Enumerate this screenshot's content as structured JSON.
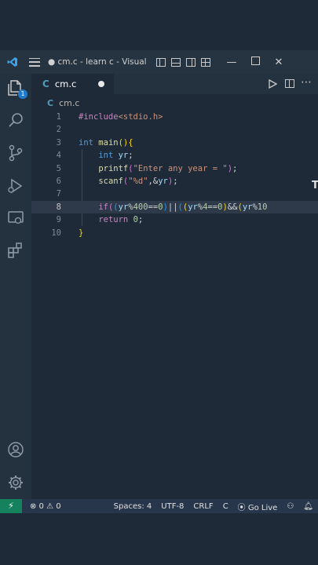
{
  "titlebar": {
    "title": "● cm.c - learn c - Visual ...",
    "minimize": "—",
    "close": "✕"
  },
  "activitybar": {
    "explorer_badge": "1"
  },
  "tab": {
    "icon_glyph": "C",
    "label": "cm.c"
  },
  "breadcrumb": {
    "icon_glyph": "C",
    "file": "cm.c"
  },
  "editor": {
    "line_numbers": [
      "1",
      "2",
      "3",
      "4",
      "5",
      "6",
      "7",
      "8",
      "9",
      "10"
    ],
    "lines": [
      "#include<stdio.h>",
      "",
      "int main(){",
      "    int yr;",
      "    printf(\"Enter any year = \");",
      "    scanf(\"%d\",&yr);",
      "",
      "    if((yr%400==0)||((yr%4==0)&&(yr%10",
      "    return 0;",
      "}"
    ]
  },
  "statusbar": {
    "remote": "⚡",
    "problems": "⊗ 0 ⚠ 0",
    "spaces": "Spaces: 4",
    "encoding": "UTF-8",
    "eol": "CRLF",
    "language": "C",
    "golive": "Go Live"
  },
  "colors": {
    "background": "#1e2a38",
    "statusbar": "#27364a",
    "remote": "#16825d",
    "c_icon": "#519aba"
  }
}
